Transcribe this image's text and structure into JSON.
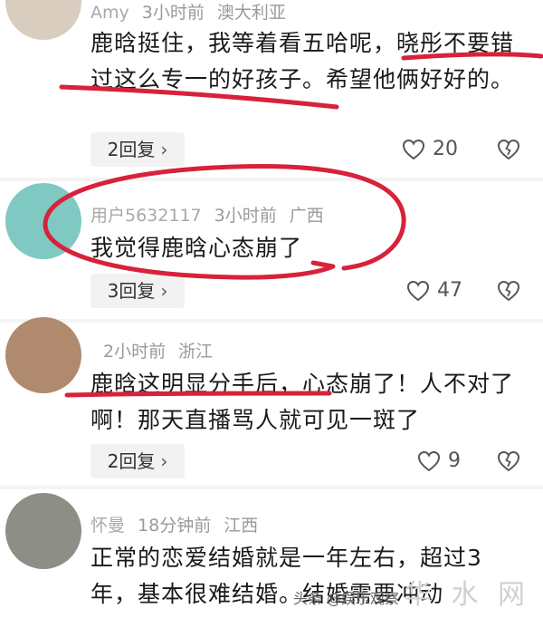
{
  "comments": [
    {
      "username": "Amy",
      "time": "3小时前",
      "location": "澳大利亚",
      "text": "鹿晗挺住，我等着看五哈呢，晓彤不要错过这么专一的好孩子。希望他俩好好的。",
      "reply_label": "2回复",
      "likes": "20",
      "avatar_color": "#d9cdbf"
    },
    {
      "username": "用户5632117",
      "time": "3小时前",
      "location": "广西",
      "text": "我觉得鹿晗心态崩了",
      "reply_label": "3回复",
      "likes": "47",
      "avatar_color": "#7fc9c2"
    },
    {
      "username": "",
      "time": "2小时前",
      "location": "浙江",
      "text": "鹿晗这明显分手后，心态崩了！人不对了啊！那天直播骂人就可见一斑了",
      "reply_label": "2回复",
      "likes": "9",
      "avatar_color": "#b08a6e"
    },
    {
      "username": "怀曼",
      "time": "18分钟前",
      "location": "江西",
      "text": "正常的恋爱结婚就是一年左右，超过3年，基本很难结婚。结婚需要冲动",
      "avatar_color": "#8d8f86"
    }
  ],
  "watermark": {
    "source": "头条 @娱乐观察",
    "logo": "华 水 网"
  },
  "colors": {
    "marker_red": "#d8213a",
    "text": "#1a1a1a",
    "meta": "#9a9a9a"
  }
}
